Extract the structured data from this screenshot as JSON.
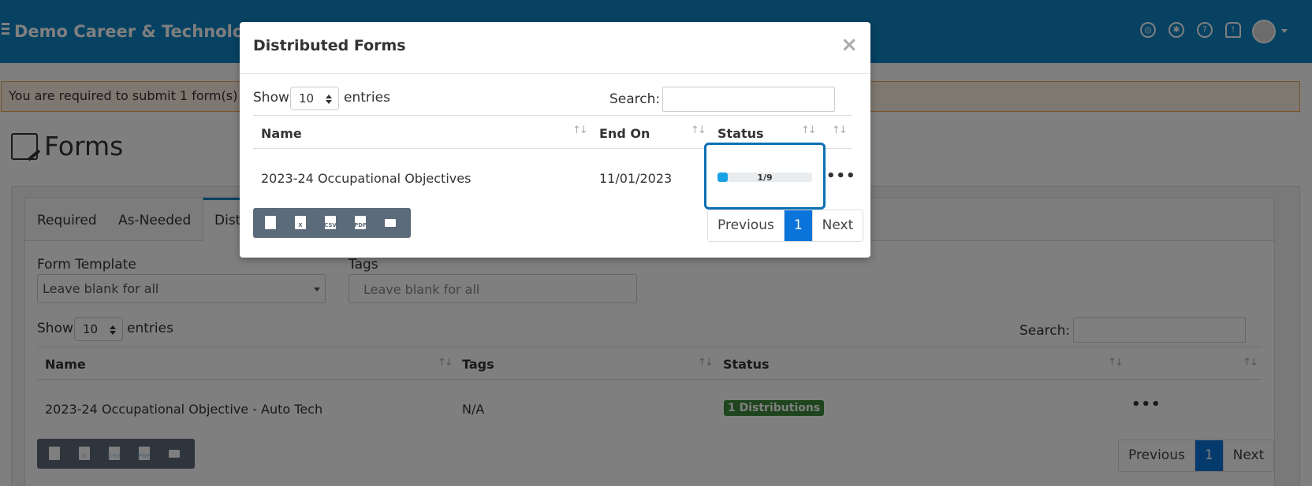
{
  "header": {
    "app_title": "Demo Career & Technology Center",
    "icons": [
      "lifebuoy-icon",
      "lightbulb-icon",
      "help-icon",
      "bell-icon",
      "avatar-icon"
    ]
  },
  "alert": {
    "text": "You are required to submit 1 form(s)"
  },
  "page": {
    "title": "Forms"
  },
  "tabs": [
    {
      "label": "Required"
    },
    {
      "label": "As-Needed"
    },
    {
      "label": "Distributed"
    }
  ],
  "filters": {
    "form_template_label": "Form Template",
    "form_template_value": "Leave blank for all",
    "tags_label": "Tags",
    "tags_placeholder": "Leave blank for all"
  },
  "table": {
    "show_label": "Show",
    "entries_value": "10",
    "entries_label": "entries",
    "search_label": "Search:",
    "columns": [
      "Name",
      "Tags",
      "Status"
    ],
    "rows": [
      {
        "name": "2023-24 Occupational Objective - Auto Tech",
        "tags": "N/A",
        "status": "1 Distributions"
      }
    ],
    "export": [
      "copy-icon",
      "excel-icon",
      "csv-icon",
      "pdf-icon",
      "print-icon"
    ],
    "pagination": {
      "previous": "Previous",
      "current": "1",
      "next": "Next"
    }
  },
  "modal": {
    "title": "Distributed Forms",
    "close": "×",
    "show_label": "Show",
    "entries_value": "10",
    "entries_label": "entries",
    "search_label": "Search:",
    "columns": [
      "Name",
      "End On",
      "Status"
    ],
    "rows": [
      {
        "name": "2023-24 Occupational Objectives",
        "end_on": "11/01/2023",
        "progress_text": "1/9",
        "progress_fraction": 0.111
      }
    ],
    "export_tags": {
      "csv": "CSV",
      "pdf": "PDF",
      "excel": "X"
    },
    "pagination": {
      "previous": "Previous",
      "current": "1",
      "next": "Next"
    }
  },
  "colors": {
    "brand": "#0e84c4",
    "alert_bg": "#fcf0e2",
    "alert_border": "#f0a64a",
    "badge_green": "#3d8b3d",
    "page_active": "#0a74da",
    "progress": "#19a2e6"
  }
}
